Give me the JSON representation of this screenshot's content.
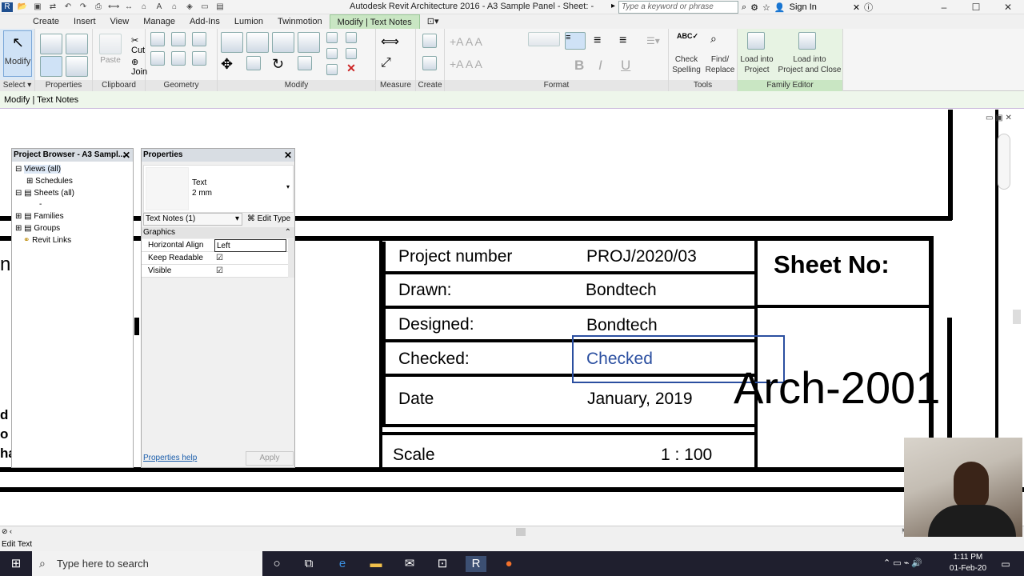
{
  "titlebar": {
    "title": "Autodesk Revit Architecture 2016 -    A3 Sample Panel - Sheet:  -",
    "search_placeholder": "Type a keyword or phrase",
    "sign_in": "Sign In",
    "qat_icons": [
      "open-icon",
      "save-icon",
      "undo-icon",
      "redo-icon",
      "print-icon",
      "measure-icon",
      "text-icon",
      "3d-icon",
      "section-icon",
      "close-hidden-icon",
      "switch-windows-icon"
    ]
  },
  "tabs": [
    "Create",
    "Insert",
    "View",
    "Manage",
    "Add-Ins",
    "Lumion",
    "Twinmotion",
    "Modify | Text Notes"
  ],
  "active_tab": "Modify | Text Notes",
  "ribbon": {
    "select": {
      "modify": "Modify",
      "label": "Select"
    },
    "properties_label": "Properties",
    "clipboard": {
      "cut": "Cut",
      "paste": "Paste",
      "join": "Join",
      "label": "Clipboard"
    },
    "geometry_label": "Geometry",
    "modify_label": "Modify",
    "measure_label": "Measure",
    "create_label": "Create",
    "format_label": "Format",
    "tools": {
      "check_spelling_1": "Check",
      "check_spelling_2": "Spelling",
      "find_replace_1": "Find/",
      "find_replace_2": "Replace",
      "label": "Tools"
    },
    "family_editor": {
      "load_1": "Load into",
      "load_2": "Project",
      "load_close_1": "Load into",
      "load_close_2": "Project and Close",
      "label": "Family Editor"
    }
  },
  "context_bar": "Modify | Text Notes",
  "project_browser": {
    "title": "Project Browser - A3 Sampl...",
    "items": [
      "Views (all)",
      "Schedules",
      "Sheets (all)",
      "-",
      "Families",
      "Groups",
      "Revit Links"
    ]
  },
  "properties": {
    "title": "Properties",
    "type_name": "Text",
    "type_size": "2 mm",
    "selector": "Text Notes (1)",
    "edit_type": "Edit Type",
    "section": "Graphics",
    "rows": [
      {
        "label": "Horizontal Align",
        "value": "Left"
      },
      {
        "label": "Keep Readable",
        "value": "☑"
      },
      {
        "label": "Visible",
        "value": "☑"
      }
    ],
    "help": "Properties help",
    "apply": "Apply"
  },
  "titleblock": {
    "project_number_label": "Project number",
    "project_number": "PROJ/2020/03",
    "drawn_label": "Drawn:",
    "drawn": "Bondtech",
    "designed_label": "Designed:",
    "designed": "Bondtech",
    "checked_label": "Checked:",
    "checked": "Checked",
    "date_label": "Date",
    "date": "January, 2019",
    "scale_label": "Scale",
    "scale": "1 : 100",
    "sheet_no_label": "Sheet No:",
    "sheet_no": "Arch-2001",
    "left_fragment_1": "n",
    "left_fragment_2": "d",
    "left_fragment_3": "o",
    "left_fragment_4": "ha"
  },
  "status_text": "Edit Text",
  "taskbar": {
    "search": "Type here to search",
    "time": "1:11 PM",
    "date": "01-Feb-20"
  }
}
